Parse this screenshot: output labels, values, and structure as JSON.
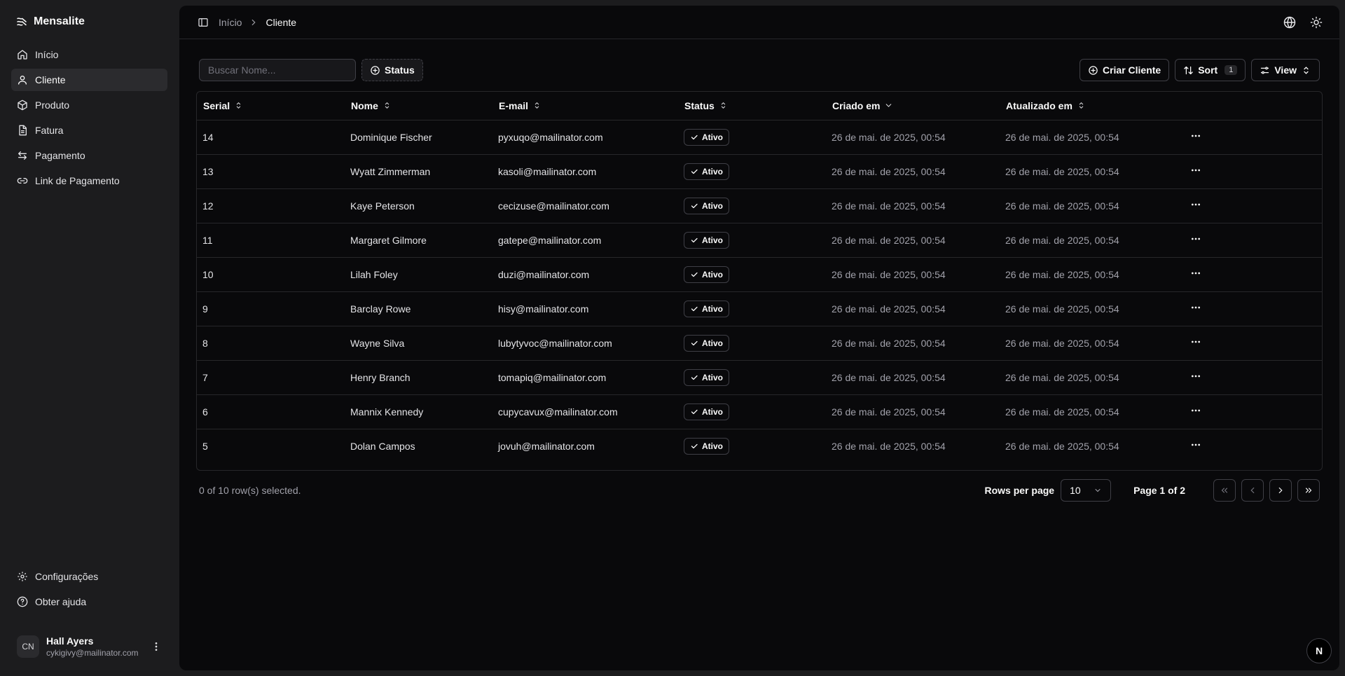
{
  "app": {
    "name": "Mensalite"
  },
  "sidebar": {
    "items": [
      {
        "label": "Início",
        "icon": "home-icon"
      },
      {
        "label": "Cliente",
        "icon": "user-icon",
        "active": true
      },
      {
        "label": "Produto",
        "icon": "box-icon"
      },
      {
        "label": "Fatura",
        "icon": "file-icon"
      },
      {
        "label": "Pagamento",
        "icon": "arrows-icon"
      },
      {
        "label": "Link de Pagamento",
        "icon": "link-icon"
      }
    ],
    "bottom": [
      {
        "label": "Configurações",
        "icon": "gear-icon"
      },
      {
        "label": "Obter ajuda",
        "icon": "help-icon"
      }
    ],
    "user": {
      "initials": "CN",
      "name": "Hall Ayers",
      "email": "cykigivy@mailinator.com"
    }
  },
  "header": {
    "breadcrumb": [
      "Início",
      "Cliente"
    ]
  },
  "toolbar": {
    "search_placeholder": "Buscar Nome...",
    "status_filter": "Status",
    "create_label": "Criar Cliente",
    "sort_label": "Sort",
    "sort_count": "1",
    "view_label": "View"
  },
  "table": {
    "columns": [
      "Serial",
      "Nome",
      "E-mail",
      "Status",
      "Criado em",
      "Atualizado em"
    ],
    "rows": [
      {
        "serial": "14",
        "name": "Dominique Fischer",
        "email": "pyxuqo@mailinator.com",
        "status": "Ativo",
        "created": "26 de mai. de 2025, 00:54",
        "updated": "26 de mai. de 2025, 00:54"
      },
      {
        "serial": "13",
        "name": "Wyatt Zimmerman",
        "email": "kasoli@mailinator.com",
        "status": "Ativo",
        "created": "26 de mai. de 2025, 00:54",
        "updated": "26 de mai. de 2025, 00:54"
      },
      {
        "serial": "12",
        "name": "Kaye Peterson",
        "email": "cecizuse@mailinator.com",
        "status": "Ativo",
        "created": "26 de mai. de 2025, 00:54",
        "updated": "26 de mai. de 2025, 00:54"
      },
      {
        "serial": "11",
        "name": "Margaret Gilmore",
        "email": "gatepe@mailinator.com",
        "status": "Ativo",
        "created": "26 de mai. de 2025, 00:54",
        "updated": "26 de mai. de 2025, 00:54"
      },
      {
        "serial": "10",
        "name": "Lilah Foley",
        "email": "duzi@mailinator.com",
        "status": "Ativo",
        "created": "26 de mai. de 2025, 00:54",
        "updated": "26 de mai. de 2025, 00:54"
      },
      {
        "serial": "9",
        "name": "Barclay Rowe",
        "email": "hisy@mailinator.com",
        "status": "Ativo",
        "created": "26 de mai. de 2025, 00:54",
        "updated": "26 de mai. de 2025, 00:54"
      },
      {
        "serial": "8",
        "name": "Wayne Silva",
        "email": "lubytyvoc@mailinator.com",
        "status": "Ativo",
        "created": "26 de mai. de 2025, 00:54",
        "updated": "26 de mai. de 2025, 00:54"
      },
      {
        "serial": "7",
        "name": "Henry Branch",
        "email": "tomapiq@mailinator.com",
        "status": "Ativo",
        "created": "26 de mai. de 2025, 00:54",
        "updated": "26 de mai. de 2025, 00:54"
      },
      {
        "serial": "6",
        "name": "Mannix Kennedy",
        "email": "cupycavux@mailinator.com",
        "status": "Ativo",
        "created": "26 de mai. de 2025, 00:54",
        "updated": "26 de mai. de 2025, 00:54"
      },
      {
        "serial": "5",
        "name": "Dolan Campos",
        "email": "jovuh@mailinator.com",
        "status": "Ativo",
        "created": "26 de mai. de 2025, 00:54",
        "updated": "26 de mai. de 2025, 00:54"
      }
    ]
  },
  "pagination": {
    "selected_text": "0 of 10 row(s) selected.",
    "rows_per_page_label": "Rows per page",
    "rows_per_page_value": "10",
    "page_info": "Page 1 of 2"
  },
  "badge": {
    "label": "N"
  }
}
